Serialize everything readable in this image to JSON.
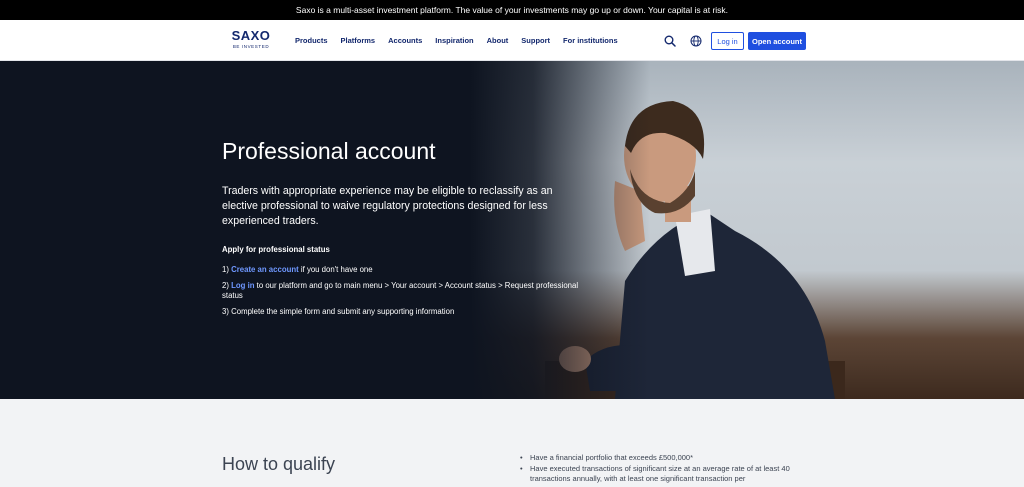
{
  "banner": {
    "text": "Saxo is a multi-asset investment platform. The value of your investments may go up or down. Your capital is at risk."
  },
  "header": {
    "logo": {
      "word": "SAXO",
      "tagline": "BE INVESTED"
    },
    "nav": [
      "Products",
      "Platforms",
      "Accounts",
      "Inspiration",
      "About",
      "Support",
      "For institutions"
    ],
    "login_label": "Log in",
    "open_account_label": "Open account"
  },
  "hero": {
    "title": "Professional account",
    "intro": "Traders with appropriate experience may be eligible to reclassify as an elective professional to waive regulatory protections designed for less experienced traders.",
    "apply_heading": "Apply for professional status",
    "steps": [
      {
        "prefix": "1) ",
        "link": "Create an account",
        "suffix": " if you don't have one"
      },
      {
        "prefix": "2) ",
        "link": "Log in",
        "suffix": " to our platform and go to main menu > Your account > Account status > Request professional status"
      },
      {
        "prefix": "3) ",
        "link": "",
        "suffix": "Complete the simple form and submit any supporting information"
      }
    ]
  },
  "qualify": {
    "title": "How to qualify",
    "items": [
      "Have a financial portfolio that exceeds £500,000*",
      "Have executed transactions of significant size at an average rate of at least 40 transactions annually, with at least one significant transaction per"
    ]
  },
  "colors": {
    "brand_navy": "#13286d",
    "primary_blue": "#1f4fe0",
    "link_blue": "#6f98ff",
    "hero_dark": "#0e1420",
    "banner_black": "#000000"
  },
  "icons": {
    "search": "search-icon",
    "language": "globe-icon"
  }
}
